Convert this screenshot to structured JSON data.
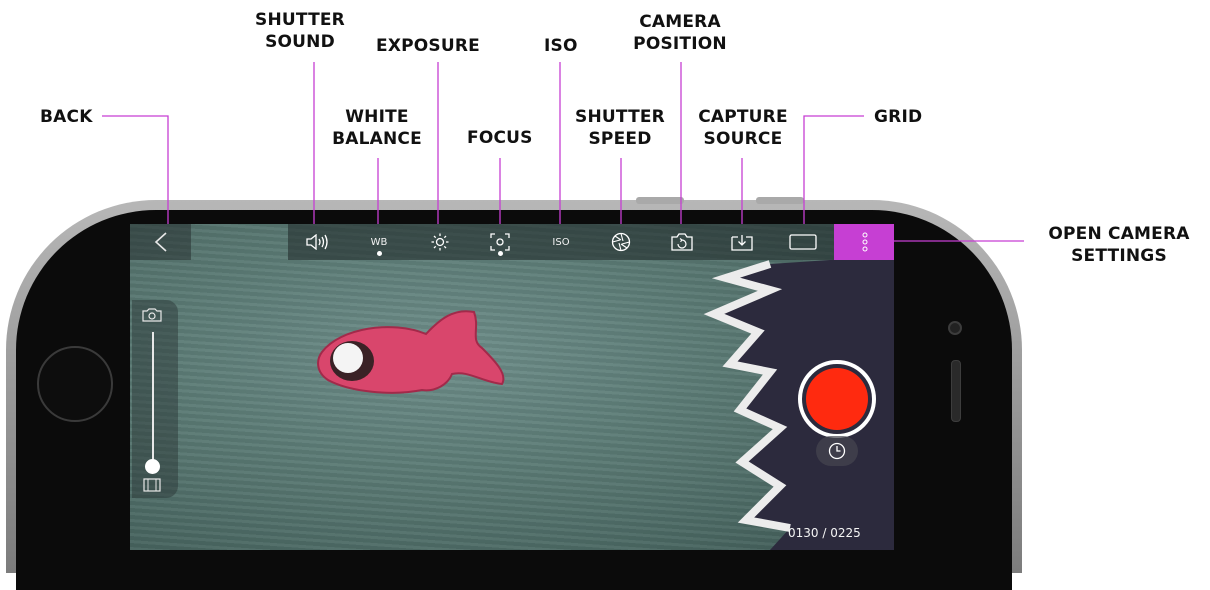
{
  "callouts": {
    "back": "BACK",
    "shutter_sound": [
      "SHUTTER",
      "SOUND"
    ],
    "white_balance": [
      "WHITE",
      "BALANCE"
    ],
    "exposure": "EXPOSURE",
    "focus": "FOCUS",
    "iso": "ISO",
    "shutter_speed": [
      "SHUTTER",
      "SPEED"
    ],
    "camera_position": [
      "CAMERA",
      "POSITION"
    ],
    "capture_source": [
      "CAPTURE",
      "SOURCE"
    ],
    "grid": "GRID",
    "open_camera_settings": [
      "OPEN CAMERA",
      "SETTINGS"
    ]
  },
  "toolbar": {
    "wb_label": "WB",
    "iso_label": "ISO",
    "icons": [
      "back-chevron-icon",
      "speaker-icon",
      "exposure-sun-icon",
      "focus-icon",
      "shutter-aperture-icon",
      "camera-rotate-icon",
      "capture-source-icon",
      "grid-rectangle-icon",
      "more-vertical-icon"
    ]
  },
  "zoom_slider": {
    "value": 0.0,
    "top_icon": "camera-icon",
    "bottom_icon": "film-icon"
  },
  "frame_counter": "0130 / 0225",
  "colors": {
    "settings_highlight": "#c63fd3",
    "record": "#ff2a0f",
    "callout_line": "#c63fd3"
  }
}
